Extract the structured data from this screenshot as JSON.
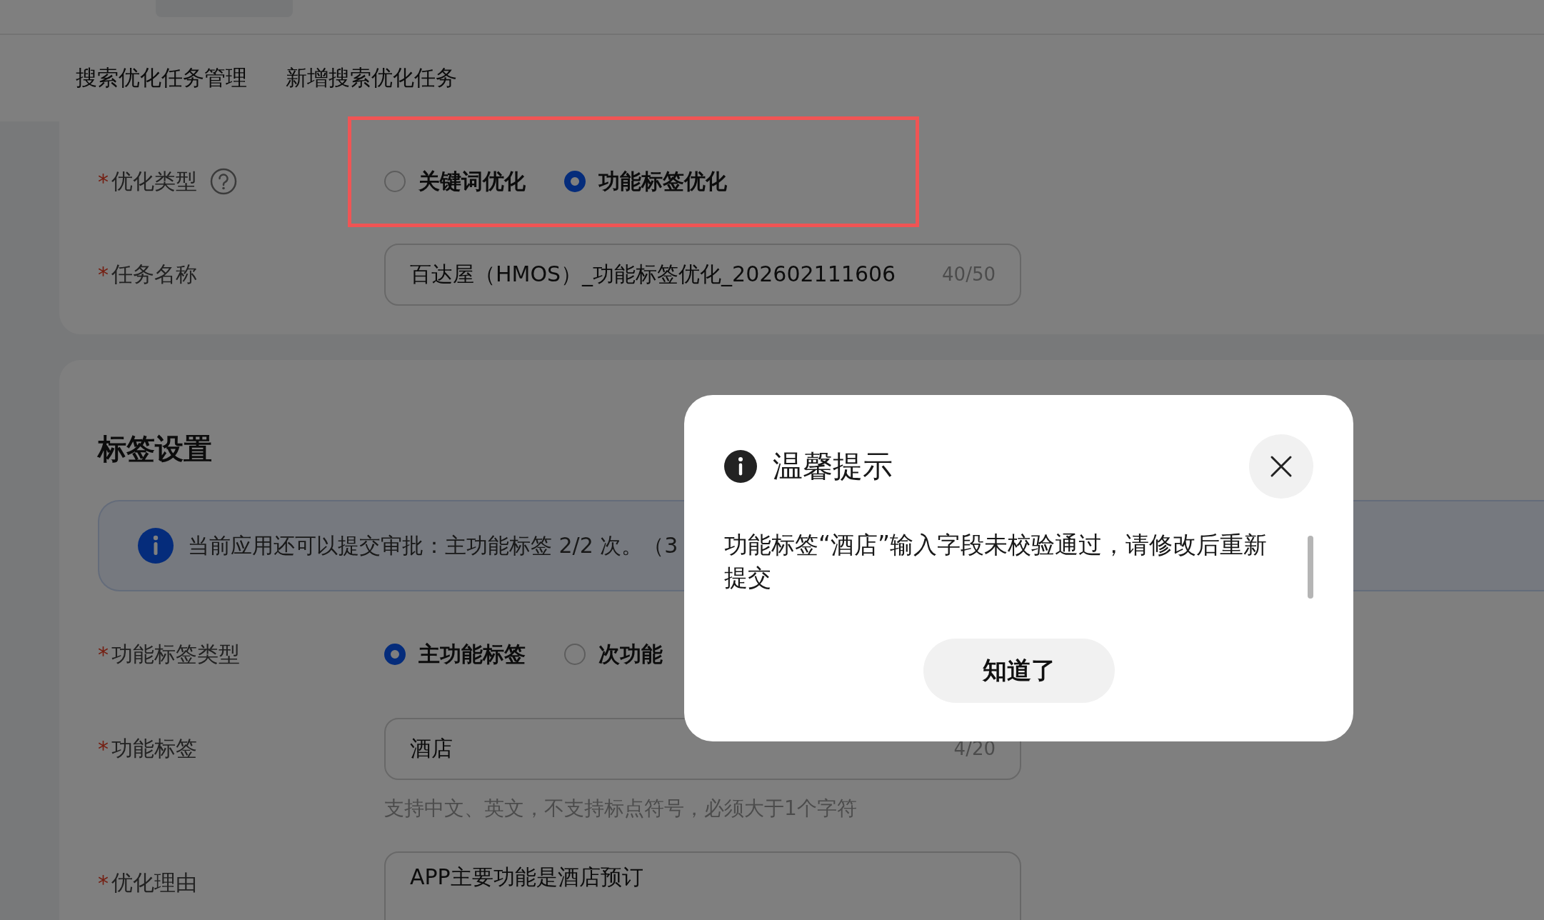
{
  "nav_tabs": [
    {
      "label": "搜索优化任务管理"
    },
    {
      "label": "新增搜索优化任务"
    }
  ],
  "basic_card": {
    "fields": [
      {
        "kind": "radio",
        "label": "优化类型",
        "required_mark": "*",
        "help": true,
        "highlighted": true,
        "options": [
          {
            "label": "关键词优化",
            "selected": false
          },
          {
            "label": "功能标签优化",
            "selected": true
          }
        ]
      },
      {
        "kind": "input",
        "label": "任务名称",
        "required_mark": "*",
        "value": "百达屋（HMOS）_功能标签优化_202602111606",
        "counter": "40/50"
      }
    ]
  },
  "tag_card": {
    "title": "标签设置",
    "notice": "当前应用还可以提交审批：主功能标签 2/2 次。（3",
    "fields": [
      {
        "kind": "radio",
        "label": "功能标签类型",
        "required_mark": "*",
        "options": [
          {
            "label": "主功能标签",
            "selected": true
          },
          {
            "label": "次功能",
            "selected": false
          }
        ]
      },
      {
        "kind": "input",
        "label": "功能标签",
        "required_mark": "*",
        "value": "酒店",
        "counter": "4/20",
        "hint": "支持中文、英文，不支持标点符号，必须大于1个字符"
      },
      {
        "kind": "textarea",
        "label": "优化理由",
        "required_mark": "*",
        "value": "APP主要功能是酒店预订"
      }
    ]
  },
  "dialog": {
    "title": "温馨提示",
    "message": "功能标签“酒店”输入字段未校验通过，请修改后重新提交",
    "button": "知道了"
  }
}
